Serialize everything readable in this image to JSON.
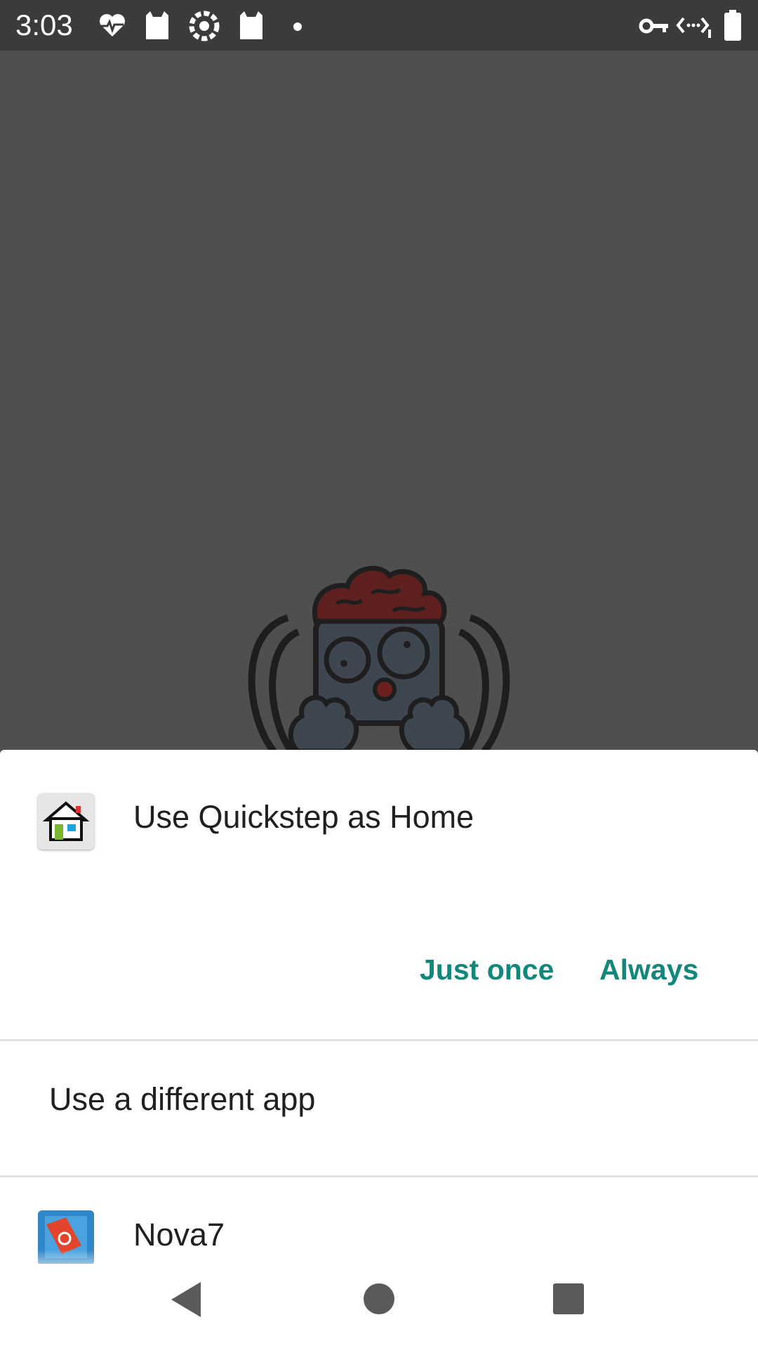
{
  "status_bar": {
    "time": "3:03",
    "notification_icons": [
      "heart-pulse-icon",
      "cat-icon",
      "sync-gear-icon",
      "cat-icon",
      "dot-icon"
    ],
    "system_icons": [
      "vpn-key-icon",
      "data-transfer-icon",
      "battery-icon"
    ]
  },
  "dialog": {
    "app_icon": "home-launcher-icon",
    "title": "Use Quickstep as Home",
    "just_once_label": "Just once",
    "always_label": "Always",
    "different_app_label": "Use a different app",
    "apps": [
      {
        "name": "Nova7",
        "icon": "nova-launcher-icon"
      }
    ]
  },
  "nav_bar": {
    "back": "back-triangle-icon",
    "home": "home-circle-icon",
    "recents": "recents-square-icon"
  },
  "colors": {
    "accent": "#12877a",
    "wallpaper": "#4f4f4f",
    "status_bar": "#3b3b3b"
  }
}
